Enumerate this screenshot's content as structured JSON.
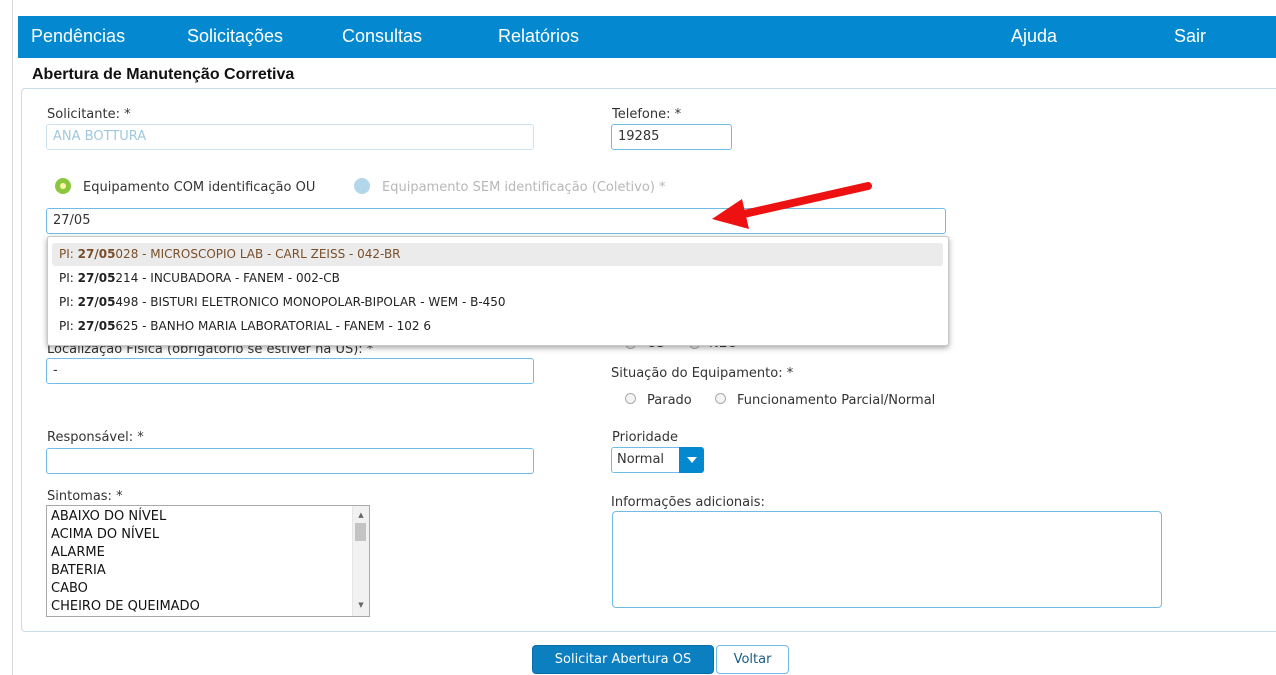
{
  "nav": {
    "items": [
      {
        "label": "Pendências"
      },
      {
        "label": "Solicitações"
      },
      {
        "label": "Consultas"
      },
      {
        "label": "Relatórios"
      },
      {
        "label": "Ajuda"
      },
      {
        "label": "Sair"
      }
    ]
  },
  "page": {
    "title": "Abertura de Manutenção Corretiva"
  },
  "form": {
    "solicitante": {
      "label": "Solicitante: *",
      "value": "ANA BOTTURA"
    },
    "telefone": {
      "label": "Telefone: *",
      "value": "19285"
    },
    "equip_com": {
      "label": "Equipamento COM identificação OU"
    },
    "equip_sem": {
      "label": "Equipamento SEM identificação (Coletivo) *"
    },
    "search": {
      "value": "27/05"
    },
    "suggestions": [
      {
        "prefix": "PI: ",
        "match": "27/05",
        "rest": "028 - MICROSCOPIO LAB - CARL ZEISS - 042-BR"
      },
      {
        "prefix": "PI: ",
        "match": "27/05",
        "rest": "214 - INCUBADORA - FANEM - 002-CB"
      },
      {
        "prefix": "PI: ",
        "match": "27/05",
        "rest": "498 - BISTURI ELETRONICO MONOPOLAR-BIPOLAR - WEM - B-450"
      },
      {
        "prefix": "PI: ",
        "match": "27/05",
        "rest": "625 - BANHO MARIA LABORATORIAL - FANEM - 102 6"
      }
    ],
    "localizacao": {
      "label": "Localização Física (obrigatório se estiver na US): *",
      "value": "-"
    },
    "us_nec": {
      "us": "US",
      "nec": "NEC"
    },
    "situacao": {
      "label": "Situação do Equipamento: *",
      "parado": "Parado",
      "funcionamento": "Funcionamento Parcial/Normal"
    },
    "responsavel": {
      "label": "Responsável: *",
      "value": ""
    },
    "prioridade": {
      "label": "Prioridade",
      "value": "Normal"
    },
    "sintomas": {
      "label": "Sintomas: *",
      "options": [
        "ABAIXO DO NÍVEL",
        "ACIMA DO NÍVEL",
        "ALARME",
        "BATERIA",
        "CABO",
        "CHEIRO DE QUEIMADO"
      ]
    },
    "info": {
      "label": "Informações adicionais:",
      "value": ""
    }
  },
  "buttons": {
    "submit": "Solicitar Abertura OS",
    "back": "Voltar"
  },
  "colors": {
    "nav_bg": "#0489d1",
    "input_border": "#6fbde6",
    "radio_checked": "#8cc63e",
    "annotation_arrow": "#ee1111"
  }
}
